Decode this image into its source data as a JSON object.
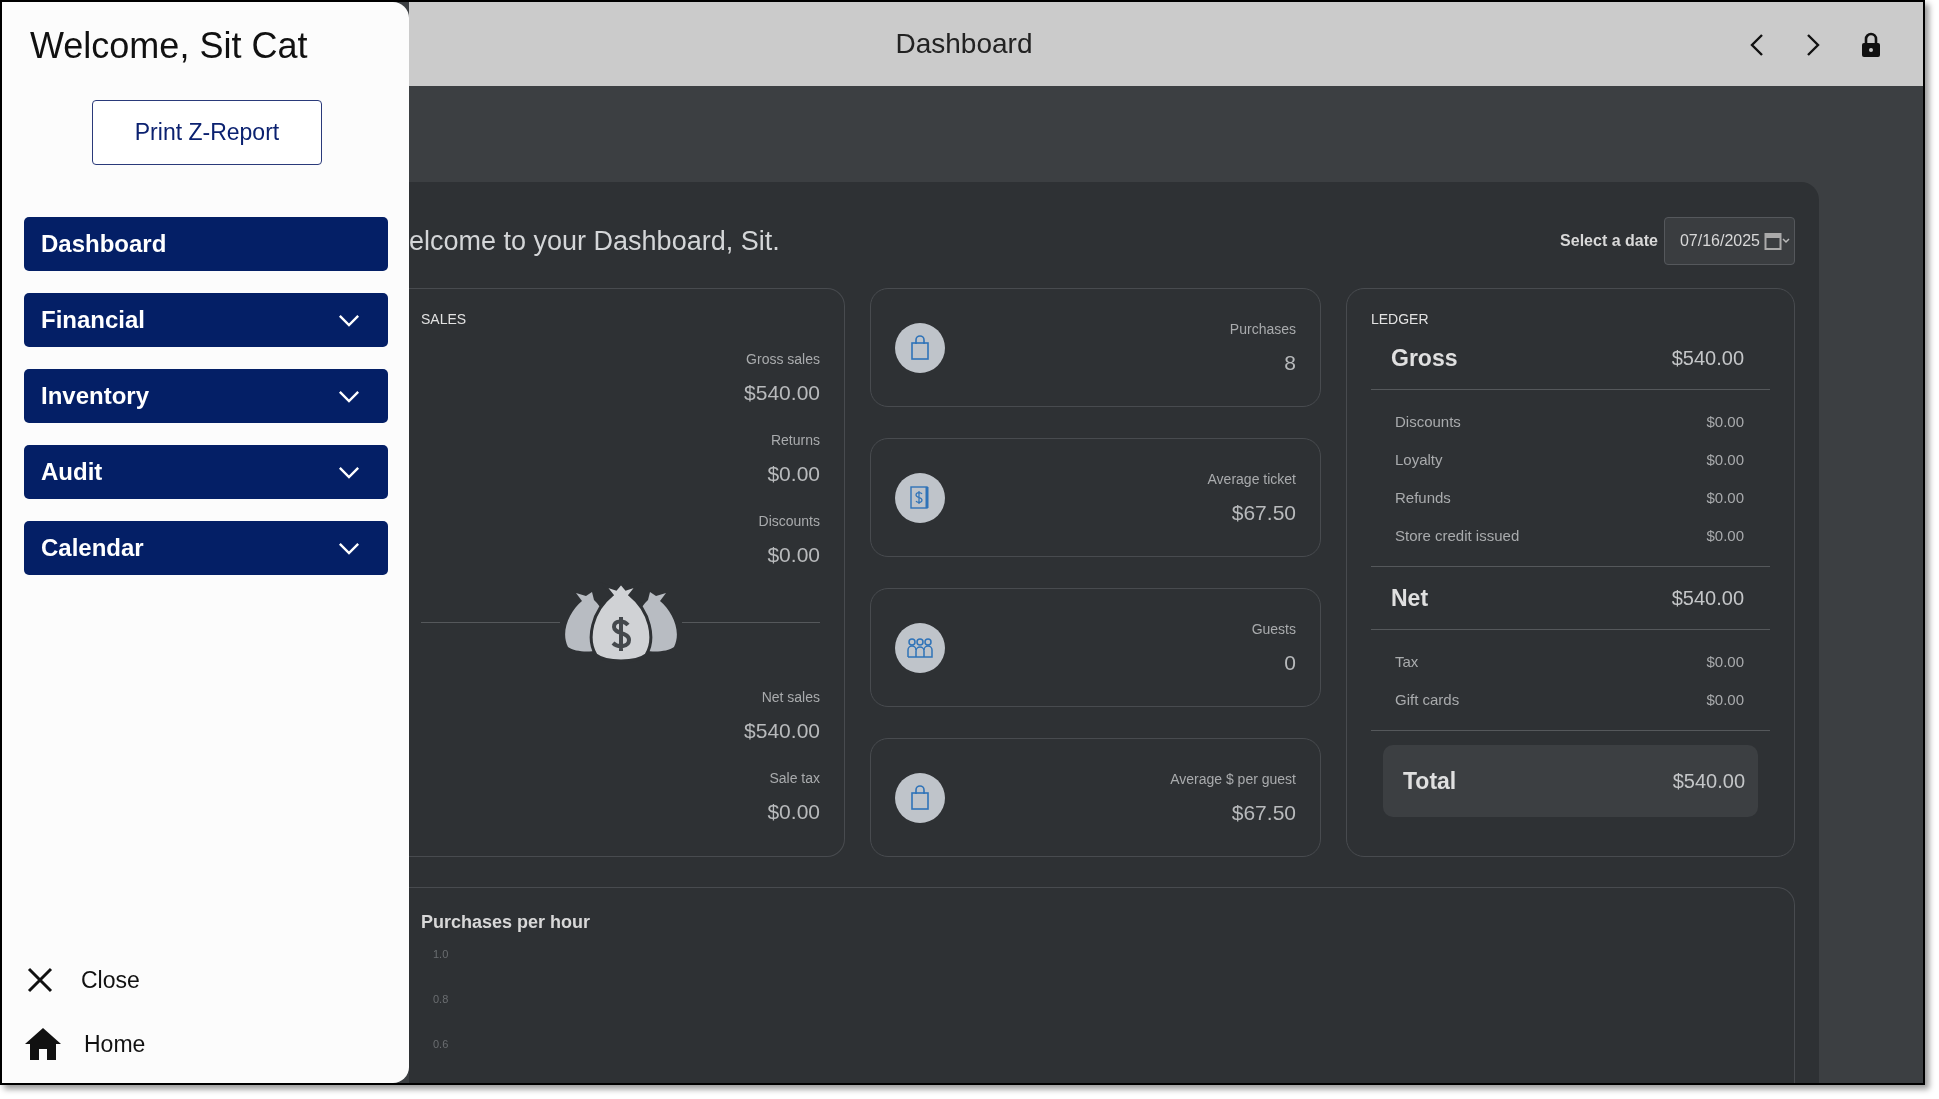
{
  "sidebar": {
    "greeting": "Welcome, Sit Cat",
    "report_button": "Print Z-Report",
    "items": [
      {
        "label": "Dashboard",
        "expandable": false
      },
      {
        "label": "Financial",
        "expandable": true
      },
      {
        "label": "Inventory",
        "expandable": true
      },
      {
        "label": "Audit",
        "expandable": true
      },
      {
        "label": "Calendar",
        "expandable": true
      }
    ],
    "footer": [
      {
        "kind": "close",
        "label": "Close"
      },
      {
        "kind": "home",
        "label": "Home"
      }
    ]
  },
  "header": {
    "title": "Dashboard"
  },
  "dashboard": {
    "welcome": "elcome to your Dashboard, Sit.",
    "date_label": "Select a date",
    "date_value": "07/16/2025"
  },
  "sales": {
    "title": "SALES",
    "top": [
      {
        "label": "Gross sales",
        "value": "$540.00"
      },
      {
        "label": "Returns",
        "value": "$0.00"
      },
      {
        "label": "Discounts",
        "value": "$0.00"
      }
    ],
    "bottom": [
      {
        "label": "Net sales",
        "value": "$540.00"
      },
      {
        "label": "Sale tax",
        "value": "$0.00"
      }
    ]
  },
  "stats": [
    {
      "kind": "bag",
      "label": "Purchases",
      "value": "8"
    },
    {
      "kind": "receipt",
      "label": "Average ticket",
      "value": "$67.50"
    },
    {
      "kind": "guests",
      "label": "Guests",
      "value": "0"
    },
    {
      "kind": "bag",
      "label": "Average $ per guest",
      "value": "$67.50"
    }
  ],
  "ledger": {
    "title": "LEDGER",
    "rows": [
      {
        "kind": "major",
        "label": "Gross",
        "value": "$540.00"
      },
      {
        "kind": "minor",
        "label": "Discounts",
        "value": "$0.00"
      },
      {
        "kind": "minor",
        "label": "Loyalty",
        "value": "$0.00"
      },
      {
        "kind": "minor",
        "label": "Refunds",
        "value": "$0.00"
      },
      {
        "kind": "minor",
        "label": "Store credit issued",
        "value": "$0.00"
      },
      {
        "kind": "major",
        "label": "Net",
        "value": "$540.00"
      },
      {
        "kind": "minor",
        "label": "Tax",
        "value": "$0.00"
      },
      {
        "kind": "minor",
        "label": "Gift cards",
        "value": "$0.00"
      },
      {
        "kind": "total",
        "label": "Total",
        "value": "$540.00"
      }
    ]
  },
  "chart": {
    "title": "Purchases per hour",
    "axis_labels": [
      "1.0",
      "0.8",
      "0.6"
    ]
  }
}
